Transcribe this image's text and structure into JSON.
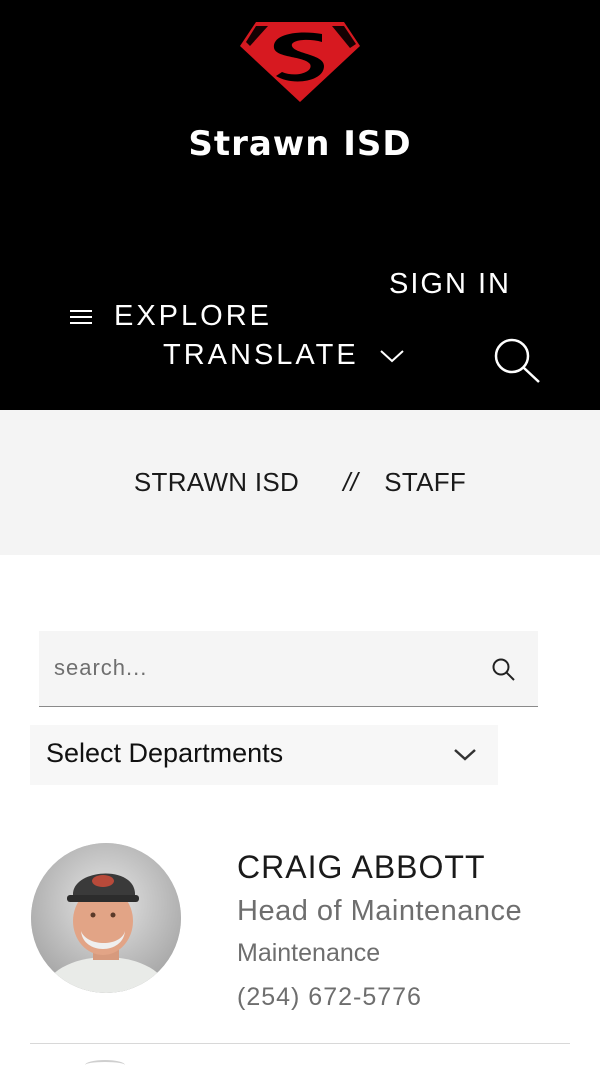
{
  "header": {
    "site_title": "Strawn ISD",
    "logo_icon": "superman-shield-logo",
    "sign_in_label": "SIGN IN",
    "explore_label": "EXPLORE",
    "translate_label": "TRANSLATE",
    "colors": {
      "background": "#000000",
      "text": "#ffffff",
      "logo": "#d71920"
    }
  },
  "breadcrumb": {
    "items": [
      "STRAWN ISD",
      "STAFF"
    ],
    "separator": "//"
  },
  "search": {
    "placeholder": "search...",
    "value": ""
  },
  "department_filter": {
    "selected": "Select Departments"
  },
  "staff": [
    {
      "name": "CRAIG ABBOTT",
      "title": "Head of Maintenance",
      "department": "Maintenance",
      "phone": "(254) 672-5776"
    }
  ]
}
